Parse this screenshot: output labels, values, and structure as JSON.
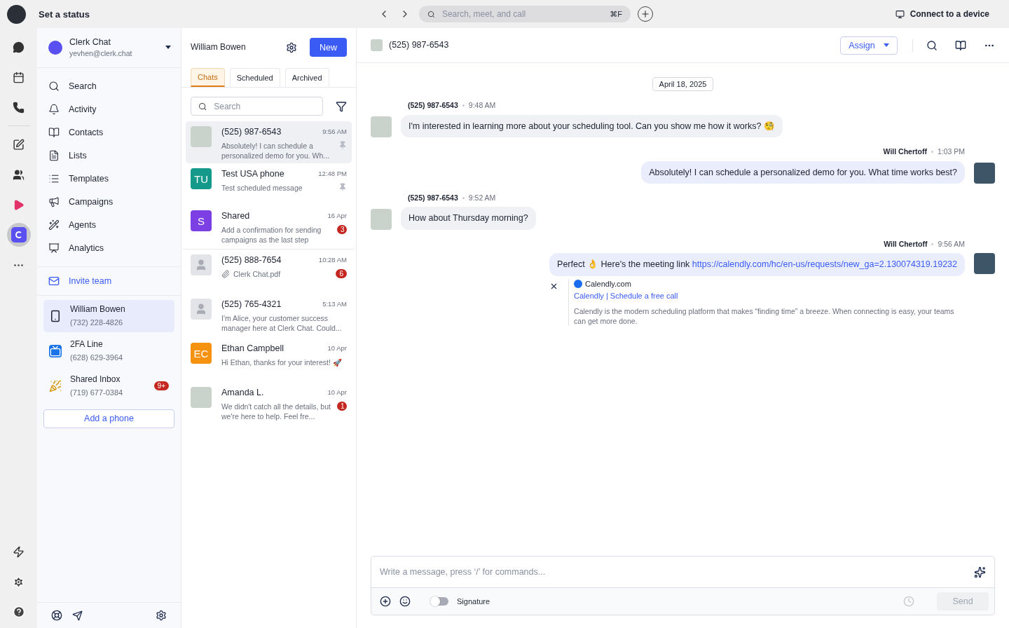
{
  "topbar": {
    "status": "Set a status",
    "search_placeholder": "Search, meet, and call",
    "shortcut": "⌘F",
    "connect": "Connect to a device"
  },
  "rail": {
    "items": [
      {
        "kind": "chat",
        "selected": false
      },
      {
        "kind": "calendar",
        "selected": false
      },
      {
        "kind": "phone",
        "selected": false
      },
      {
        "kind": "compose",
        "selected": false
      },
      {
        "kind": "team",
        "selected": false
      },
      {
        "kind": "play",
        "selected": false
      },
      {
        "kind": "brand",
        "selected": true
      },
      {
        "kind": "more",
        "selected": false
      }
    ],
    "bottom": [
      {
        "kind": "bolt"
      },
      {
        "kind": "settings"
      },
      {
        "kind": "help"
      }
    ]
  },
  "workspace": {
    "name": "Clerk Chat",
    "email": "yevhen@clerk.chat"
  },
  "nav": [
    {
      "label": "Search",
      "kind": "search"
    },
    {
      "label": "Activity",
      "kind": "bell"
    },
    {
      "label": "Contacts",
      "kind": "book"
    },
    {
      "label": "Lists",
      "kind": "list"
    },
    {
      "label": "Templates",
      "kind": "template"
    },
    {
      "label": "Campaigns",
      "kind": "megaphone"
    },
    {
      "label": "Agents",
      "kind": "wand"
    },
    {
      "label": "Analytics",
      "kind": "chart"
    }
  ],
  "invite": "Invite team",
  "phones": [
    {
      "name": "William Bowen",
      "number": "(732) 228-4826",
      "kind": "mobile",
      "selected": true
    },
    {
      "name": "2FA Line",
      "number": "(628) 629-3964",
      "kind": "tv",
      "selected": false
    },
    {
      "name": "Shared Inbox",
      "number": "(719) 677-0384",
      "kind": "party",
      "selected": false,
      "badge": "9+"
    }
  ],
  "add_phone": "Add a phone",
  "list": {
    "owner": "William Bowen",
    "new": "New",
    "tabs": [
      {
        "label": "Chats",
        "selected": true
      },
      {
        "label": "Scheduled",
        "selected": false
      },
      {
        "label": "Archived",
        "selected": false
      }
    ],
    "search_placeholder": "Search"
  },
  "conversations": [
    {
      "name": "(525) 987-6543",
      "time": "9:56 AM",
      "preview": "Absolutely! I can schedule a personalized demo for you. Wh...",
      "kind": "photo",
      "pinned": true,
      "selected": true
    },
    {
      "name": "Test USA phone",
      "time": "12:48 PM",
      "preview": "Test scheduled message",
      "kind": "initials",
      "initials": "TU",
      "color": "#15998a",
      "pinned": true,
      "selected": false
    },
    {
      "name": "Shared",
      "time": "16 Apr",
      "preview": "Add a confirmation for sending campaigns as the last step",
      "kind": "initials",
      "initials": "S",
      "color": "#7b3fe4",
      "badge": "3",
      "pinned": false,
      "selected": false
    },
    {
      "name": "(525) 888-7654",
      "time": "10:28 AM",
      "preview": "Clerk Chat.pdf",
      "attachment": true,
      "kind": "placeholder",
      "badge": "6",
      "pinned": false,
      "selected": false
    },
    {
      "name": "(525) 765-4321",
      "time": "5:13 AM",
      "preview": "I'm Alice, your customer success manager here at Clerk Chat. Could...",
      "kind": "placeholder",
      "pinned": false,
      "selected": false
    },
    {
      "name": "Ethan Campbell",
      "time": "10 Apr",
      "preview": "Hi Ethan, thanks for your interest! 🚀",
      "kind": "initials",
      "initials": "EC",
      "color": "#f5920f",
      "pinned": false,
      "selected": false
    },
    {
      "name": "Amanda L.",
      "time": "10 Apr",
      "preview": "We didn't catch all the details, but we're here to help. Feel fre...",
      "kind": "photo",
      "badge": "1",
      "pinned": false,
      "selected": false
    }
  ],
  "conversation": {
    "title": "(525) 987-6543",
    "assign": "Assign",
    "date": "April 18, 2025",
    "messages": [
      {
        "kind": "incoming",
        "sender": "(525) 987-6543",
        "time": "9:48 AM",
        "text": "I'm interested in learning more about your scheduling tool. Can you show me how it works? 🧐"
      },
      {
        "kind": "outgoing",
        "sender": "Will Chertoff",
        "time": "1:03 PM",
        "text": "Absolutely! I can schedule a personalized demo for you. What time works best?"
      },
      {
        "kind": "incoming",
        "sender": "(525) 987-6543",
        "time": "9:52 AM",
        "text": "How about Thursday morning?"
      },
      {
        "kind": "outgoing",
        "sender": "Will Chertoff",
        "time": "9:56 AM",
        "text": "Perfect 👌 Here's the meeting link",
        "link": "https://calendly.com/hc/en-us/requests/new_ga=2.130074319.19232",
        "preview": {
          "site": "Calendly.com",
          "title": "Calendly | Schedule a free call",
          "description": "Calendly is the modern scheduling platform that makes “finding time” a breeze. When connecting is easy, your teams can get more done."
        }
      }
    ]
  },
  "composer": {
    "placeholder": "Write a message, press ‘/’ for commands...",
    "signature": "Signature",
    "signature_on": false,
    "send": "Send",
    "send_disabled": true
  }
}
